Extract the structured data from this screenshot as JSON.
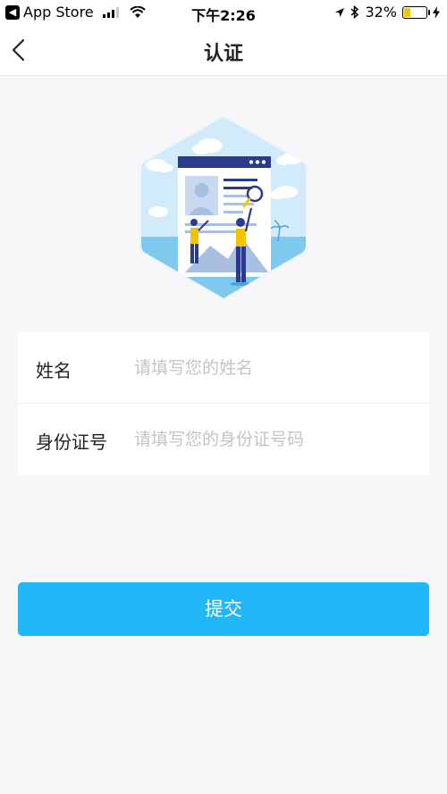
{
  "status_bar": {
    "back_app": "App Store",
    "time": "下午2:26",
    "battery_percent": "32%",
    "battery_level": 0.32,
    "icons": [
      "back-arrow-icon",
      "signal-icon",
      "wifi-icon",
      "location-icon",
      "bluetooth-icon",
      "battery-icon",
      "charging-icon"
    ]
  },
  "nav": {
    "title": "认证",
    "back_icon": "chevron-left-icon"
  },
  "form": {
    "name": {
      "label": "姓名",
      "placeholder": "请填写您的姓名",
      "value": ""
    },
    "id_number": {
      "label": "身份证号",
      "placeholder": "请填写您的身份证号码",
      "value": ""
    }
  },
  "actions": {
    "submit_label": "提交"
  },
  "colors": {
    "primary": "#1fb7f5",
    "background": "#f7f7fa",
    "placeholder": "#c4c4c8",
    "illustration_navy": "#2b3a8c",
    "illustration_yellow": "#f5c400"
  }
}
